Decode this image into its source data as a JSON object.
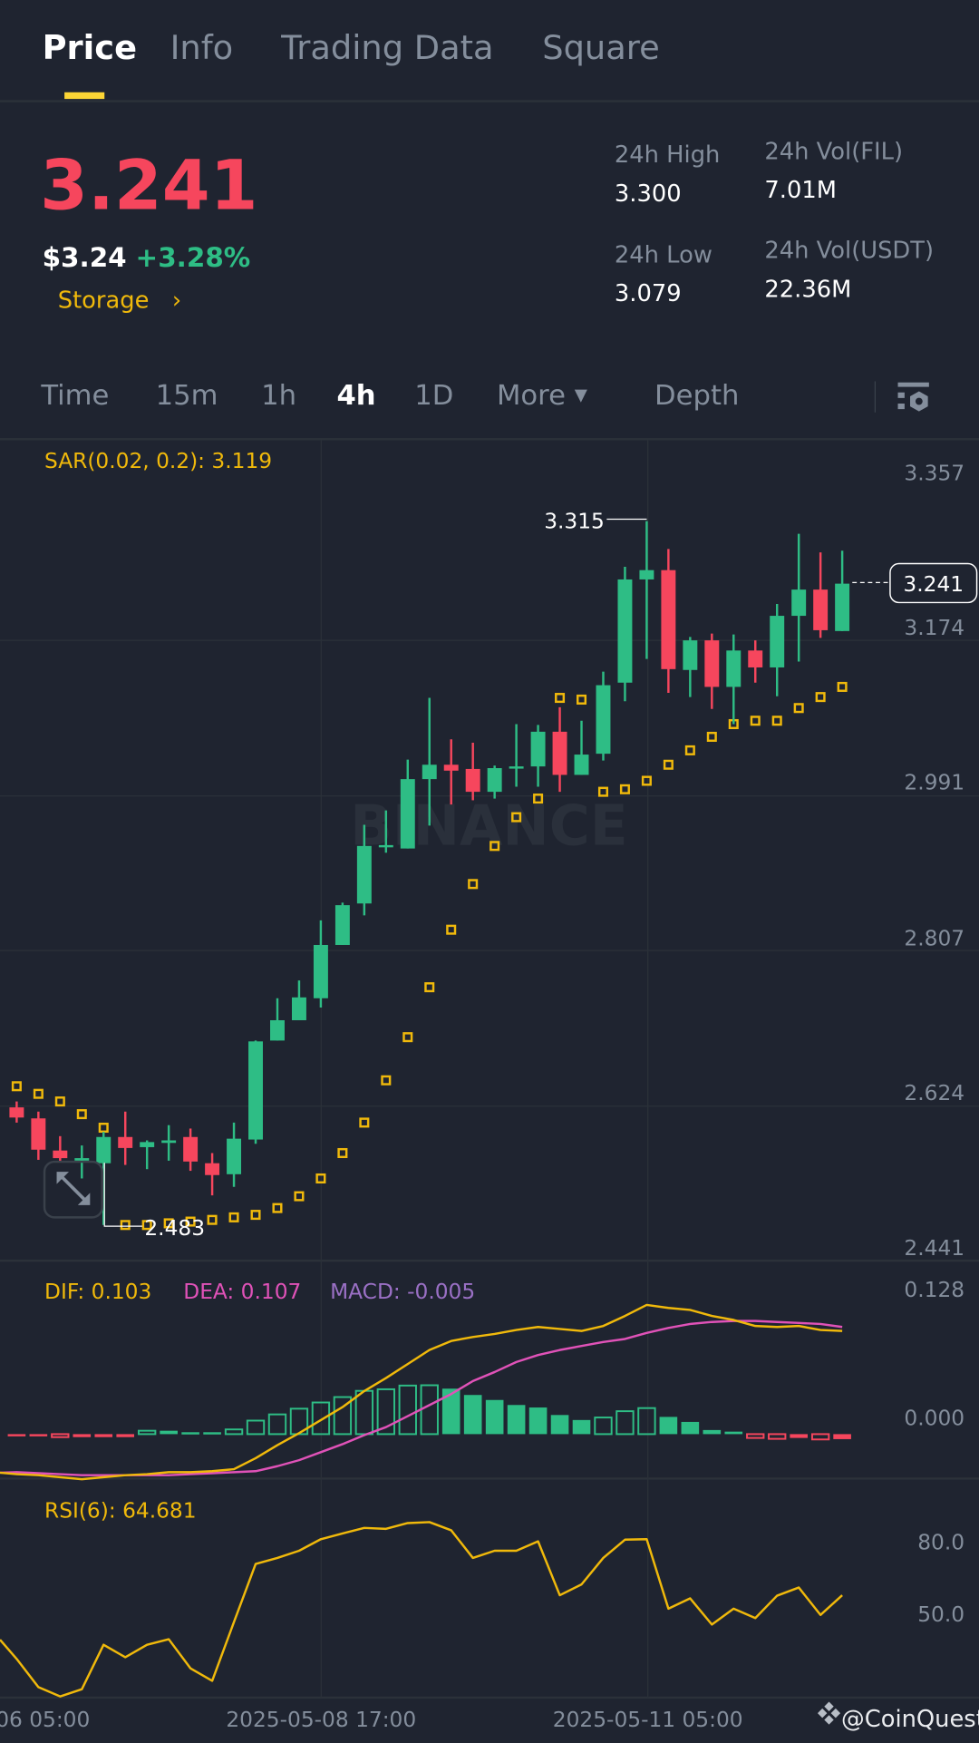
{
  "tabs": [
    {
      "label": "Price",
      "active": true
    },
    {
      "label": "Info"
    },
    {
      "label": "Trading Data"
    },
    {
      "label": "Square"
    }
  ],
  "ticker": {
    "last_price": "3.241",
    "usd_price": "$3.24",
    "change": "+3.28%",
    "category": "Storage",
    "category_chevron": "›"
  },
  "stats": {
    "high_label": "24h High",
    "high": "3.300",
    "low_label": "24h Low",
    "low": "3.079",
    "vol_base_label": "24h Vol(FIL)",
    "vol_base": "7.01M",
    "vol_quote_label": "24h Vol(USDT)",
    "vol_quote": "22.36M"
  },
  "intervals": {
    "items": [
      "Time",
      "15m",
      "1h",
      "4h",
      "1D"
    ],
    "active": "4h",
    "more": "More",
    "depth": "Depth",
    "settings_icon": "chart-settings-icon"
  },
  "colors": {
    "up": "#2ebd85",
    "down": "#f6465d",
    "accent": "#f0b90b",
    "dif": "#f0b90b",
    "dea": "#e052b8",
    "macd": "#9a70c5",
    "bg": "#1f2430"
  },
  "indicators": {
    "sar": "SAR(0.02, 0.2): 3.119",
    "dif": "DIF: 0.103",
    "dea": "DEA: 0.107",
    "macd": "MACD: -0.005",
    "rsi": "RSI(6): 64.681"
  },
  "watermark": "BINANCE",
  "footer": {
    "brand": "@CoinQuest"
  },
  "chart_data": {
    "type": "candlestick",
    "interval": "4h",
    "price_axis": {
      "ticks": [
        "3.357",
        "3.174",
        "2.991",
        "2.807",
        "2.624",
        "2.441"
      ]
    },
    "macd_axis": {
      "ticks": [
        "0.128",
        "0.000"
      ]
    },
    "rsi_axis": {
      "ticks": [
        "80.0",
        "50.0"
      ]
    },
    "x_ticks": [
      "06 05:00",
      "2025-05-08 17:00",
      "2025-05-11 05:00"
    ],
    "current_price": "3.241",
    "max_label": "3.315",
    "min_label": "2.483",
    "ohlc": [
      [
        2.622,
        2.629,
        2.604,
        2.61
      ],
      [
        2.609,
        2.617,
        2.56,
        2.572
      ],
      [
        2.571,
        2.588,
        2.558,
        2.562
      ],
      [
        2.559,
        2.577,
        2.538,
        2.562
      ],
      [
        2.556,
        2.593,
        2.483,
        2.587
      ],
      [
        2.587,
        2.617,
        2.554,
        2.574
      ],
      [
        2.575,
        2.583,
        2.549,
        2.581
      ],
      [
        2.58,
        2.601,
        2.559,
        2.583
      ],
      [
        2.587,
        2.597,
        2.547,
        2.558
      ],
      [
        2.556,
        2.568,
        2.518,
        2.542
      ],
      [
        2.543,
        2.604,
        2.528,
        2.585
      ],
      [
        2.584,
        2.701,
        2.579,
        2.7
      ],
      [
        2.701,
        2.751,
        2.701,
        2.725
      ],
      [
        2.725,
        2.772,
        2.725,
        2.752
      ],
      [
        2.751,
        2.843,
        2.74,
        2.814
      ],
      [
        2.814,
        2.864,
        2.814,
        2.861
      ],
      [
        2.863,
        2.956,
        2.849,
        2.931
      ],
      [
        2.93,
        2.973,
        2.923,
        2.932
      ],
      [
        2.928,
        3.033,
        2.928,
        3.01
      ],
      [
        3.01,
        3.106,
        2.955,
        3.027
      ],
      [
        3.027,
        3.057,
        2.98,
        3.02
      ],
      [
        3.022,
        3.053,
        2.985,
        2.995
      ],
      [
        2.995,
        3.026,
        2.987,
        3.023
      ],
      [
        3.023,
        3.075,
        3.001,
        3.025
      ],
      [
        3.025,
        3.074,
        3.001,
        3.066
      ],
      [
        3.066,
        3.095,
        2.995,
        3.015
      ],
      [
        3.015,
        3.079,
        3.015,
        3.039
      ],
      [
        3.04,
        3.137,
        3.032,
        3.121
      ],
      [
        3.124,
        3.261,
        3.102,
        3.246
      ],
      [
        3.246,
        3.315,
        3.152,
        3.257
      ],
      [
        3.257,
        3.282,
        3.112,
        3.14
      ],
      [
        3.139,
        3.178,
        3.107,
        3.174
      ],
      [
        3.174,
        3.182,
        3.093,
        3.119
      ],
      [
        3.119,
        3.181,
        3.075,
        3.162
      ],
      [
        3.162,
        3.174,
        3.124,
        3.142
      ],
      [
        3.142,
        3.217,
        3.108,
        3.203
      ],
      [
        3.203,
        3.3,
        3.149,
        3.234
      ],
      [
        3.234,
        3.278,
        3.177,
        3.186
      ],
      [
        3.185,
        3.28,
        3.185,
        3.241
      ]
    ],
    "sar": [
      2.647,
      2.638,
      2.629,
      2.614,
      2.598,
      2.483,
      2.483,
      2.485,
      2.487,
      2.489,
      2.492,
      2.495,
      2.503,
      2.517,
      2.538,
      2.568,
      2.604,
      2.654,
      2.705,
      2.764,
      2.832,
      2.886,
      2.931,
      2.965,
      2.987,
      3.106,
      3.104,
      2.995,
      2.998,
      3.008,
      3.027,
      3.044,
      3.06,
      3.075,
      3.079,
      3.079,
      3.094,
      3.107,
      3.119
    ],
    "dif": [
      -0.04,
      -0.041,
      -0.043,
      -0.045,
      -0.043,
      -0.041,
      -0.04,
      -0.038,
      -0.038,
      -0.037,
      -0.035,
      -0.024,
      -0.011,
      0.001,
      0.014,
      0.027,
      0.043,
      0.056,
      0.07,
      0.084,
      0.093,
      0.097,
      0.1,
      0.104,
      0.107,
      0.105,
      0.103,
      0.108,
      0.118,
      0.129,
      0.126,
      0.124,
      0.118,
      0.114,
      0.108,
      0.107,
      0.108,
      0.104,
      0.103
    ],
    "dea": [
      -0.038,
      -0.039,
      -0.04,
      -0.041,
      -0.041,
      -0.041,
      -0.041,
      -0.041,
      -0.04,
      -0.039,
      -0.038,
      -0.037,
      -0.032,
      -0.026,
      -0.018,
      -0.01,
      -0.001,
      0.007,
      0.018,
      0.029,
      0.04,
      0.053,
      0.062,
      0.072,
      0.079,
      0.084,
      0.088,
      0.092,
      0.095,
      0.101,
      0.106,
      0.11,
      0.112,
      0.113,
      0.113,
      0.112,
      0.111,
      0.11,
      0.107
    ],
    "macd_hist": [
      -0.002,
      -0.0016,
      -0.003,
      -0.003,
      -0.003,
      -0.003,
      0.0034,
      0.0034,
      0.0019,
      0.0019,
      0.0047,
      0.0135,
      0.0197,
      0.0254,
      0.0316,
      0.037,
      0.0432,
      0.0448,
      0.0485,
      0.0488,
      0.0454,
      0.0391,
      0.0341,
      0.0291,
      0.0266,
      0.0191,
      0.0141,
      0.0166,
      0.0229,
      0.026,
      0.0172,
      0.0122,
      0.0041,
      0.0025,
      -0.0038,
      -0.0047,
      -0.0038,
      -0.0053,
      -0.005
    ],
    "rsi": [
      38.2,
      26.5,
      22.6,
      25.6,
      44.1,
      38.9,
      44.1,
      46.4,
      34.3,
      29.1,
      53.5,
      77.7,
      80.2,
      83.2,
      88.0,
      90.4,
      92.7,
      92.3,
      94.7,
      95.1,
      91.7,
      80.2,
      83.2,
      83.2,
      87.1,
      64.7,
      69.2,
      80.2,
      87.8,
      88.0,
      59.1,
      63.4,
      52.5,
      59.1,
      55.2,
      64.5,
      67.9,
      56.5,
      64.681
    ]
  }
}
